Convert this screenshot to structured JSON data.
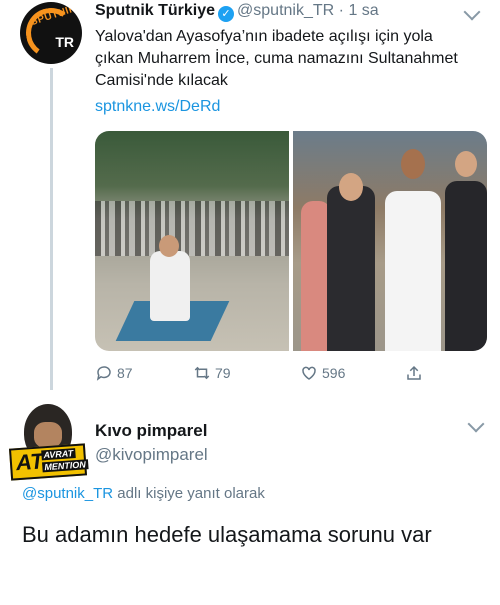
{
  "tweet1": {
    "author_name": "Sputnik Türkiye",
    "handle": "@sputnik_TR",
    "separator": "·",
    "time": "1 sa",
    "avatar_text": "SPUTNIK",
    "avatar_cc": "TR",
    "text": "Yalova'dan Ayasofya’nın ibadete açılışı için yola çıkan Muharrem İnce, cuma namazını Sultanahmet Camisi'nde kılacak",
    "link": "sptnkne.ws/DeRd",
    "replies": "87",
    "retweets": "79",
    "likes": "596"
  },
  "tweet2": {
    "author_name": "Kıvo pimparel",
    "handle": "@kivopimparel",
    "avatar_badge_big": "AT",
    "avatar_badge_line1": "AVRAT",
    "avatar_badge_line2": "MENTION",
    "reply_to_handle": "@sputnik_TR",
    "reply_to_suffix": " adlı kişiye yanıt olarak",
    "text": "Bu adamın hedefe ulaşamama sorunu var"
  },
  "colors": {
    "link": "#1b95e0",
    "muted": "#657786",
    "verified": "#1da1f2",
    "brand_orange": "#f7931e"
  }
}
